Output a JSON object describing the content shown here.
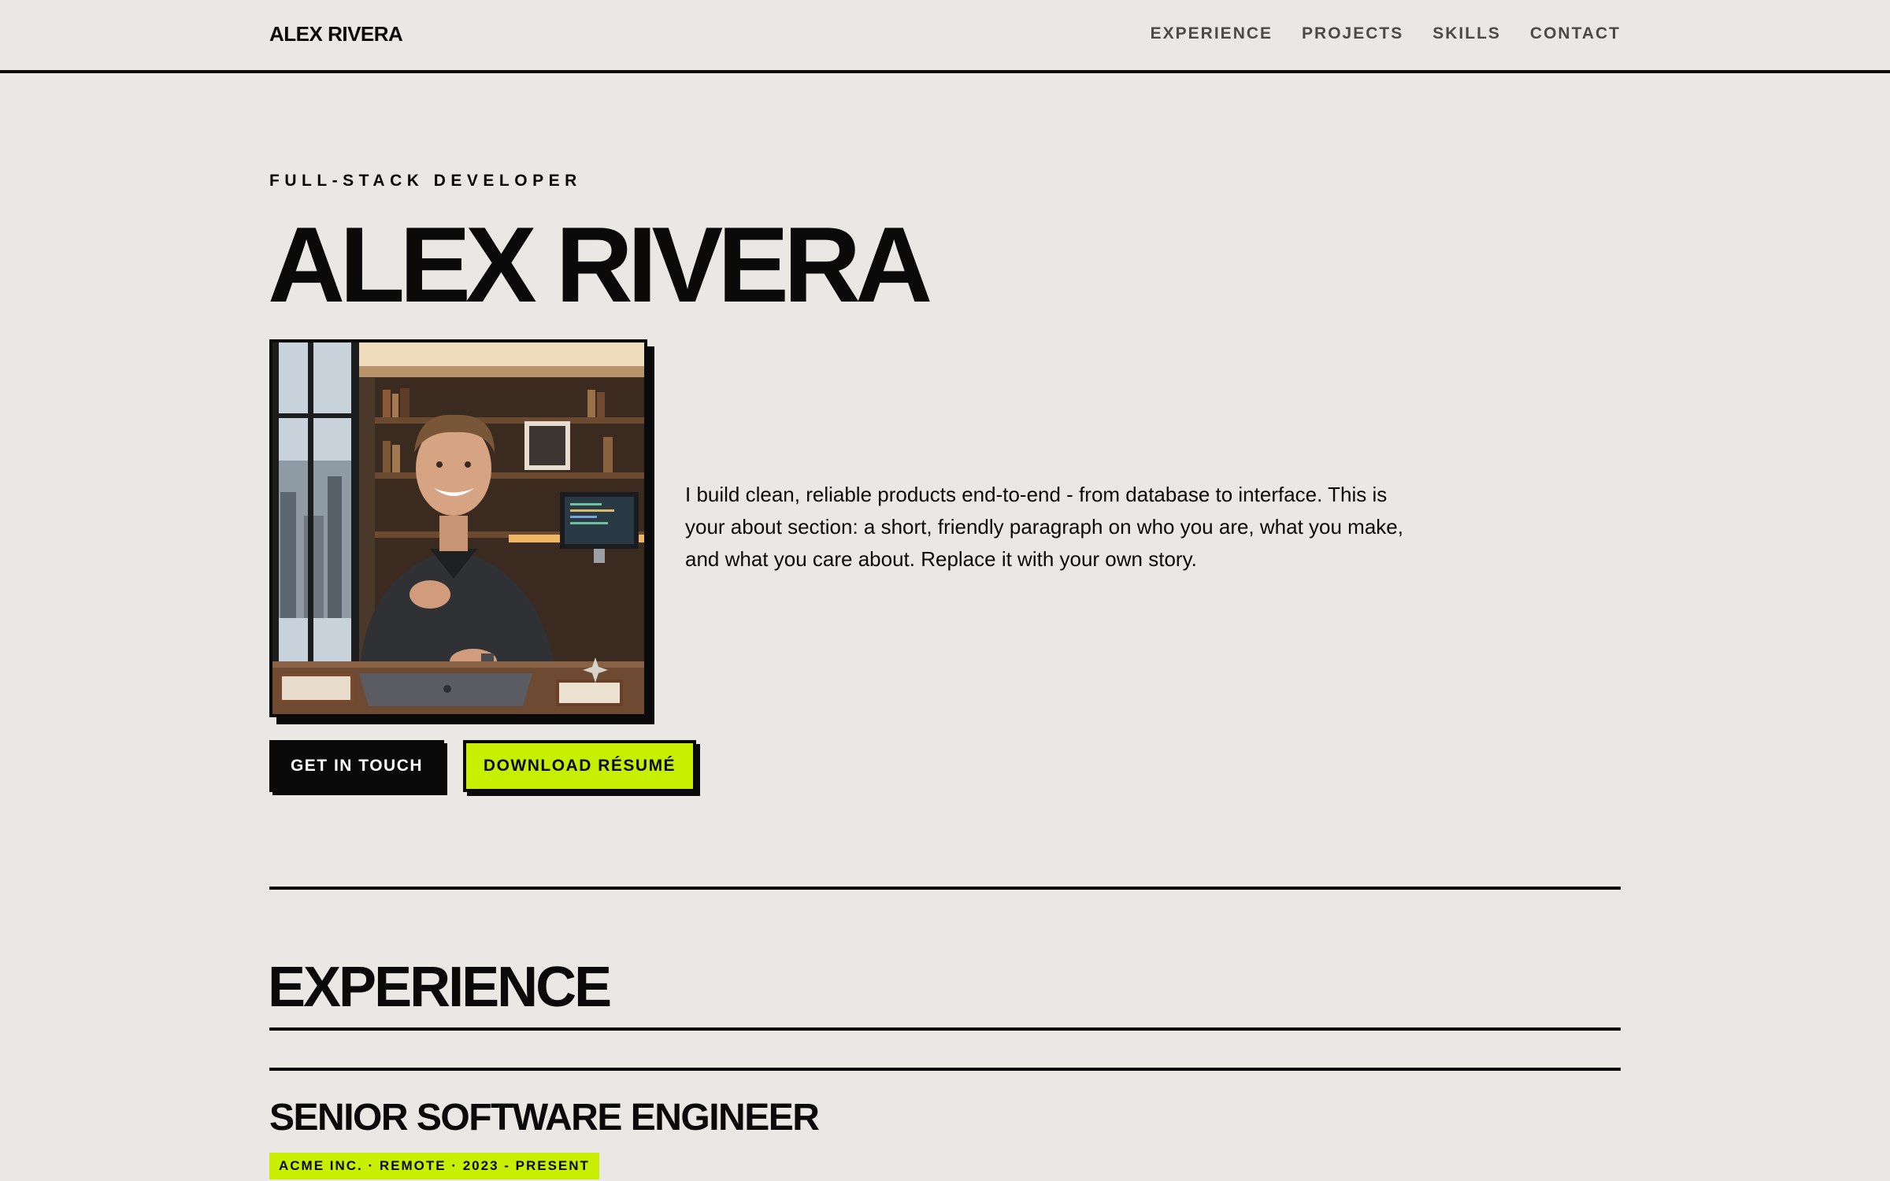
{
  "header": {
    "brand": "ALEX RIVERA",
    "nav": [
      "EXPERIENCE",
      "PROJECTS",
      "SKILLS",
      "CONTACT"
    ]
  },
  "hero": {
    "eyebrow": "FULL-STACK DEVELOPER",
    "name": "ALEX RIVERA",
    "about": "I build clean, reliable products end-to-end - from database to interface. This is your about section: a short, friendly paragraph on who you are, what you make, and what you care about. Replace it with your own story.",
    "buttons": {
      "primary": "GET IN TOUCH",
      "secondary": "DOWNLOAD RÉSUMÉ"
    }
  },
  "experience": {
    "title": "EXPERIENCE",
    "jobs": [
      {
        "title": "SENIOR SOFTWARE ENGINEER",
        "meta": "ACME INC. · REMOTE · 2023 - PRESENT"
      }
    ]
  },
  "colors": {
    "background": "#e9e8e4",
    "ink": "#0a0a0a",
    "accent": "#c8ef00"
  }
}
